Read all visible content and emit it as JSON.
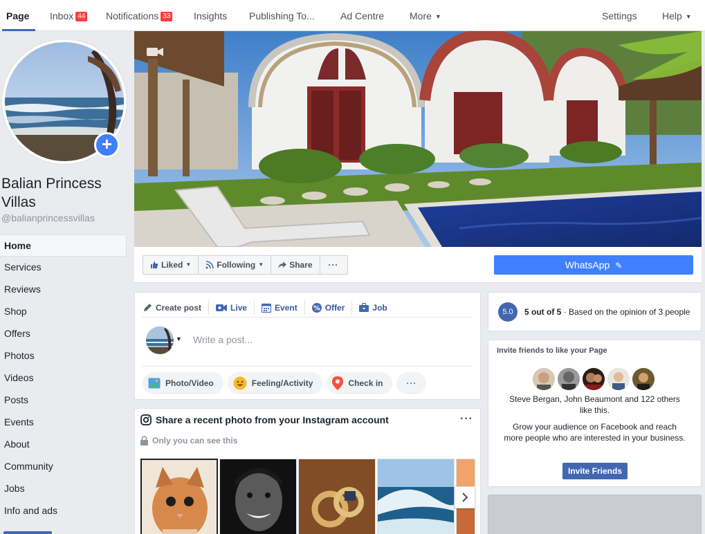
{
  "topbar": {
    "tabs": [
      {
        "label": "Page"
      },
      {
        "label": "Inbox",
        "badge": "44"
      },
      {
        "label": "Notifications",
        "badge": "33"
      },
      {
        "label": "Insights"
      },
      {
        "label": "Publishing To..."
      },
      {
        "label": "Ad Centre"
      },
      {
        "label": "More"
      }
    ],
    "settings_label": "Settings",
    "help_label": "Help"
  },
  "page": {
    "name": "Balian Princess Villas",
    "handle": "@balianprincessvillas"
  },
  "leftnav": {
    "items": [
      "Home",
      "Services",
      "Reviews",
      "Shop",
      "Offers",
      "Photos",
      "Videos",
      "Posts",
      "Events",
      "About",
      "Community",
      "Jobs",
      "Info and ads"
    ]
  },
  "actions": {
    "liked_label": "Liked",
    "following_label": "Following",
    "share_label": "Share",
    "more_label": "···",
    "whatsapp_label": "WhatsApp"
  },
  "composer": {
    "tabs": [
      "Create post",
      "Live",
      "Event",
      "Offer",
      "Job"
    ],
    "placeholder": "Write a post...",
    "pills": [
      "Photo/Video",
      "Feeling/Activity",
      "Check in"
    ],
    "more_label": "···"
  },
  "instagram": {
    "title": "Share a recent photo from your Instagram account",
    "subtitle": "Only you can see this",
    "more_label": "···"
  },
  "rating": {
    "score": "5.0",
    "bold_text": "5 out of 5",
    "rest_text": " · Based on the opinion of 3 people"
  },
  "invite": {
    "title": "Invite friends to like your Page",
    "friends_text": "Steve Bergan, John Beaumont and 122 others like this.",
    "grow_text": "Grow your audience on Facebook and reach more people who are interested in your business.",
    "button_label": "Invite Friends"
  },
  "colors": {
    "brand": "#4267b2",
    "accent": "#4080ff",
    "badge": "#fa3e3e"
  }
}
